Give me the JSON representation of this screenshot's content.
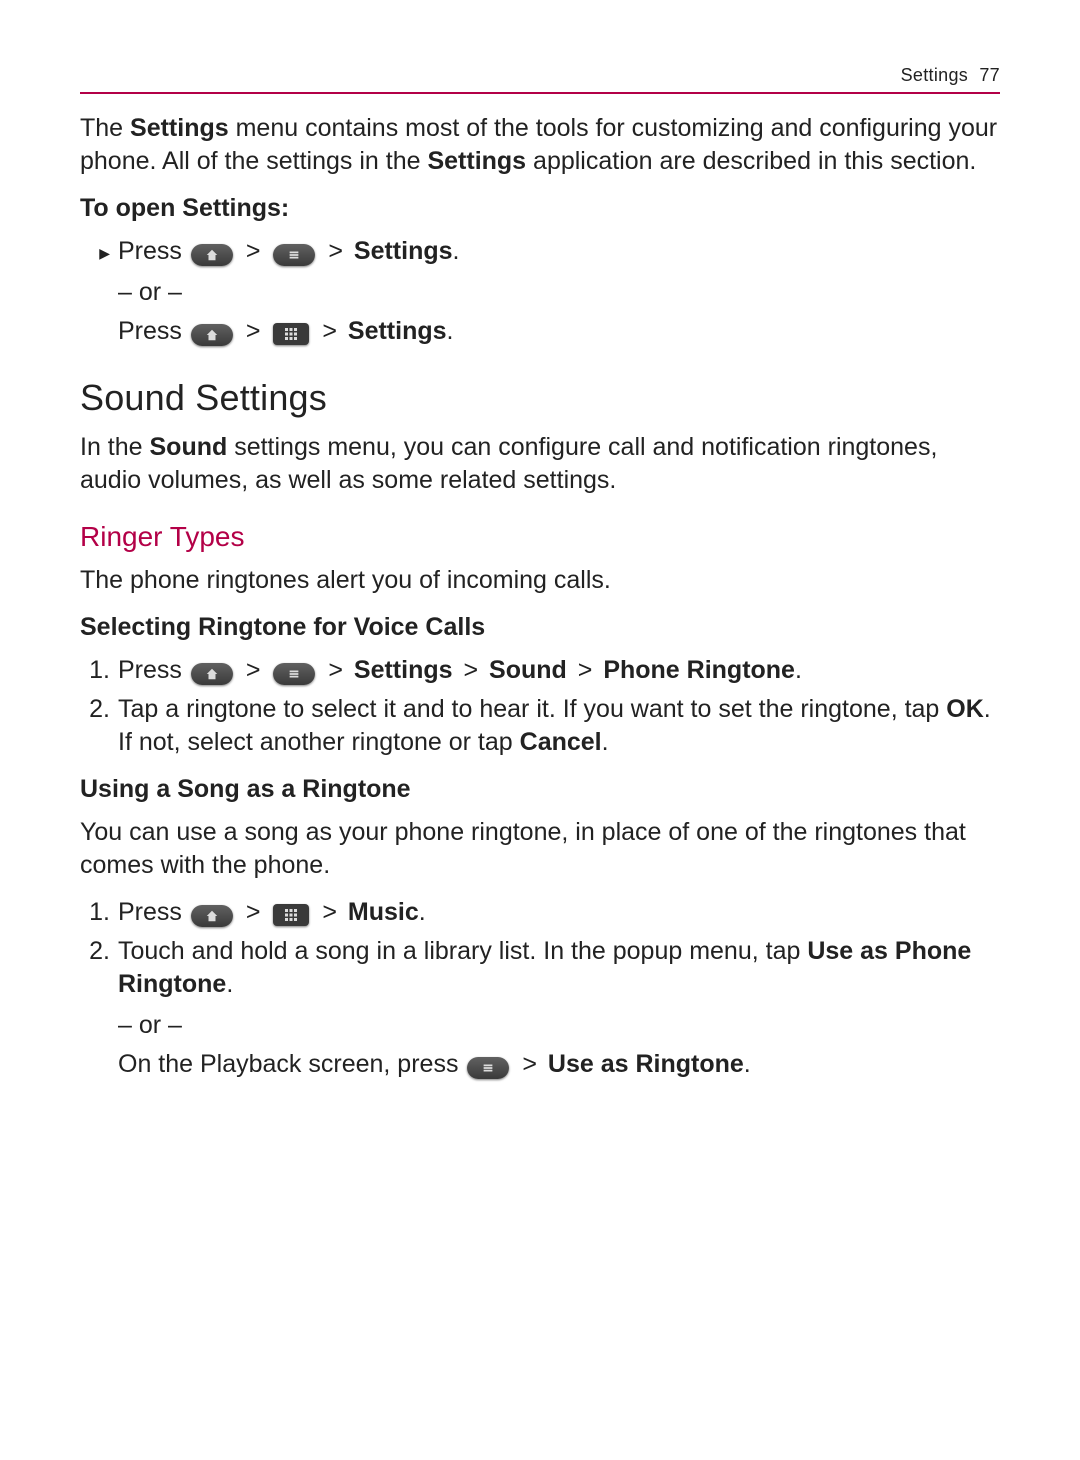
{
  "header": {
    "section": "Settings",
    "page": "77"
  },
  "intro": {
    "t1": "The ",
    "b1": "Settings",
    "t2": " menu contains most of the tools for customizing and configuring your phone. All of the settings in the ",
    "b2": "Settings",
    "t3": " application are described in this section."
  },
  "open": {
    "subhead": "To open Settings:",
    "press": "Press ",
    "settings": "Settings",
    "or": "– or –",
    "gt": ">"
  },
  "h1": "Sound Settings",
  "sound_intro": {
    "t1": "In the ",
    "b1": "Sound",
    "t2": " settings menu, you can configure call and notification ringtones, audio volumes, as well as some related settings."
  },
  "h2": "Ringer Types",
  "ringer_lead": "The phone ringtones alert you of incoming calls.",
  "sel": {
    "subhead": "Selecting Ringtone for Voice Calls",
    "n1": "1.",
    "n2": "2.",
    "step1_press": "Press ",
    "step1_settings": "Settings",
    "step1_sound": "Sound",
    "step1_ringtone": "Phone Ringtone",
    "step2_a": "Tap a ringtone to select it and to hear it. If you want to set the ringtone, tap ",
    "step2_ok": "OK",
    "step2_b": ". If not, select another ringtone or tap ",
    "step2_cancel": "Cancel",
    "step2_c": "."
  },
  "song": {
    "subhead": "Using a Song as a Ringtone",
    "lead": "You can use a song as your phone ringtone, in place of one of the ringtones that comes with the phone.",
    "n1": "1.",
    "n2": "2.",
    "step1_press": "Press ",
    "step1_music": "Music",
    "step2_a": "Touch and hold a song in a library list. In the popup menu, tap ",
    "step2_b": "Use as Phone Ringtone",
    "step2_c": ".",
    "or": "– or –",
    "pb_a": "On the Playback screen, press ",
    "pb_b": "Use as Ringtone",
    "pb_c": "."
  }
}
